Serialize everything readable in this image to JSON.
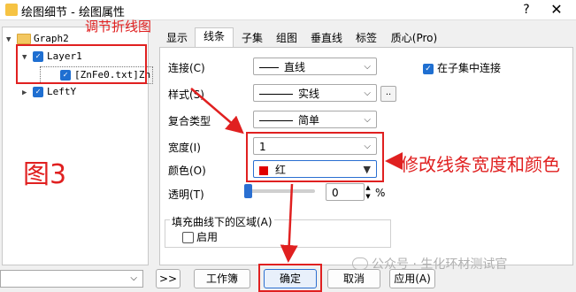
{
  "window": {
    "title": "绘图细节 - 绘图属性",
    "help": "?",
    "close": "✕"
  },
  "tree": {
    "items": [
      {
        "label": "Graph2"
      },
      {
        "label": "Layer1"
      },
      {
        "label": "[ZnFe0.txt]Zn"
      },
      {
        "label": "LeftY"
      }
    ]
  },
  "tabs": [
    "显示",
    "线条",
    "子集",
    "组图",
    "垂直线",
    "标签",
    "质心(Pro)"
  ],
  "active_tab": "线条",
  "form": {
    "connect_label": "连接(C)",
    "connect_value": "直线",
    "style_label": "样式(S)",
    "style_value": "实线",
    "compound_label": "复合类型",
    "compound_value": "简单",
    "width_label": "宽度(I)",
    "width_value": "1",
    "color_label": "颜色(O)",
    "color_value": "红",
    "color_hex": "#e00000",
    "transparency_label": "透明(T)",
    "transparency_value": "0",
    "transparency_unit": "%",
    "transparency_fraction": 0.0,
    "connect_in_subset": "在子集中连接",
    "fill_group_label": "填充曲线下的区域(A)",
    "enable_label": "启用",
    "ellipsis": ".."
  },
  "bottom": {
    "nav_button": ">>",
    "workbook": "工作簿",
    "ok": "确定",
    "cancel": "取消",
    "apply": "应用(A)"
  },
  "annotations": {
    "adjust_line": "调节折线图",
    "figure": "图3",
    "modify": "修改线条宽度和颜色",
    "watermark": "公众号 · 生化环材测试官"
  }
}
